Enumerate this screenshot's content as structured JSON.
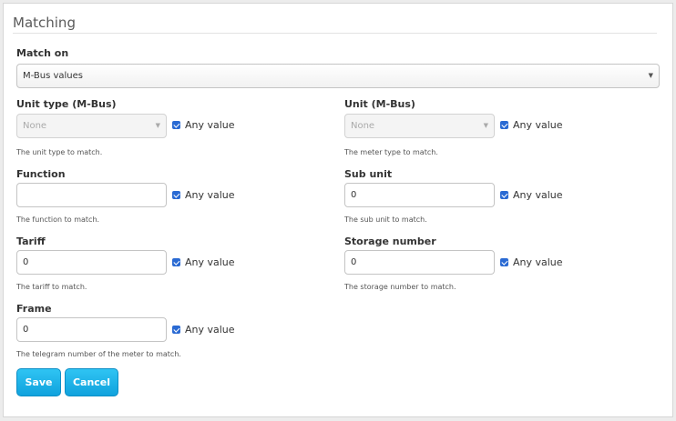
{
  "section": {
    "title": "Matching"
  },
  "match_on": {
    "label": "Match on",
    "value": "M-Bus values"
  },
  "unit_type": {
    "label": "Unit type (M-Bus)",
    "value": "None",
    "any_label": "Any value",
    "help": "The unit type to match."
  },
  "unit": {
    "label": "Unit (M-Bus)",
    "value": "None",
    "any_label": "Any value",
    "help": "The meter type to match."
  },
  "function": {
    "label": "Function",
    "value": "",
    "any_label": "Any value",
    "help": "The function to match."
  },
  "sub_unit": {
    "label": "Sub unit",
    "value": "0",
    "any_label": "Any value",
    "help": "The sub unit to match."
  },
  "tariff": {
    "label": "Tariff",
    "value": "0",
    "any_label": "Any value",
    "help": "The tariff to match."
  },
  "storage_number": {
    "label": "Storage number",
    "value": "0",
    "any_label": "Any value",
    "help": "The storage number to match."
  },
  "frame": {
    "label": "Frame",
    "value": "0",
    "any_label": "Any value",
    "help": "The telegram number of the meter to match."
  },
  "buttons": {
    "save": "Save",
    "cancel": "Cancel"
  },
  "colors": {
    "accent": "#1aaee6",
    "checkbox": "#2a6ad3"
  }
}
